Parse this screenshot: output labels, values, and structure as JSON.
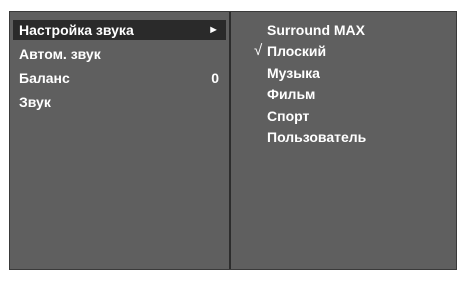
{
  "menu": {
    "items": [
      {
        "label": "Настройка звука",
        "arrow": "►",
        "selected": true
      },
      {
        "label": "Автом. звук"
      },
      {
        "label": "Баланс",
        "value": "0"
      },
      {
        "label": "Звук"
      }
    ]
  },
  "submenu": {
    "checkmark": "√",
    "options": [
      {
        "label": "Surround MAX"
      },
      {
        "label": "Плоский",
        "checked": true
      },
      {
        "label": "Музыка"
      },
      {
        "label": "Фильм"
      },
      {
        "label": "Спорт"
      },
      {
        "label": "Пользователь"
      }
    ]
  }
}
